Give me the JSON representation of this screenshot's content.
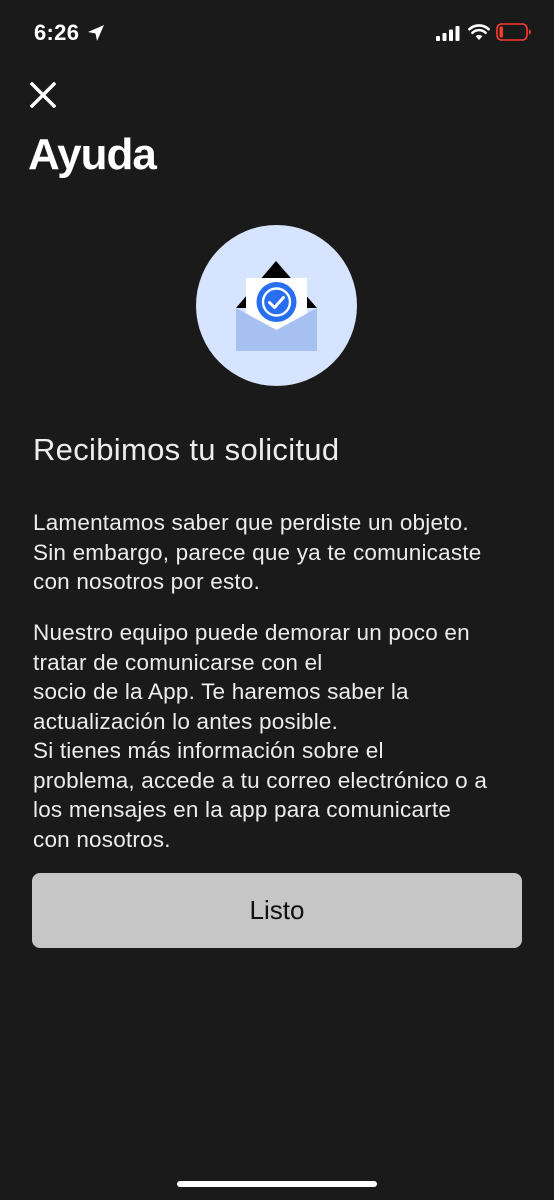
{
  "status_bar": {
    "time": "6:26",
    "icons": [
      "location-arrow-icon",
      "cellular-signal-icon",
      "wifi-icon",
      "battery-low-icon"
    ],
    "battery_color": "#ff3b30"
  },
  "header": {
    "close_icon": "close-icon",
    "title": "Ayuda"
  },
  "illustration": {
    "icon": "envelope-check-icon",
    "circle_color": "#d6e4ff",
    "accent_color": "#276ef1"
  },
  "content": {
    "heading": "Recibimos tu solicitud",
    "paragraph1": [
      "Lamentamos saber que perdiste un objeto.",
      "Sin embargo, parece que ya te comunicaste",
      "con nosotros por esto."
    ],
    "paragraph2": [
      "Nuestro equipo puede demorar un poco en",
      "tratar de comunicarse con el",
      "socio de la App. Te haremos saber la",
      "actualización lo antes posible.",
      "Si tienes más información sobre el",
      "problema, accede a tu correo electrónico o a",
      "los mensajes en la app para comunicarte",
      "con nosotros."
    ]
  },
  "actions": {
    "done_label": "Listo"
  }
}
